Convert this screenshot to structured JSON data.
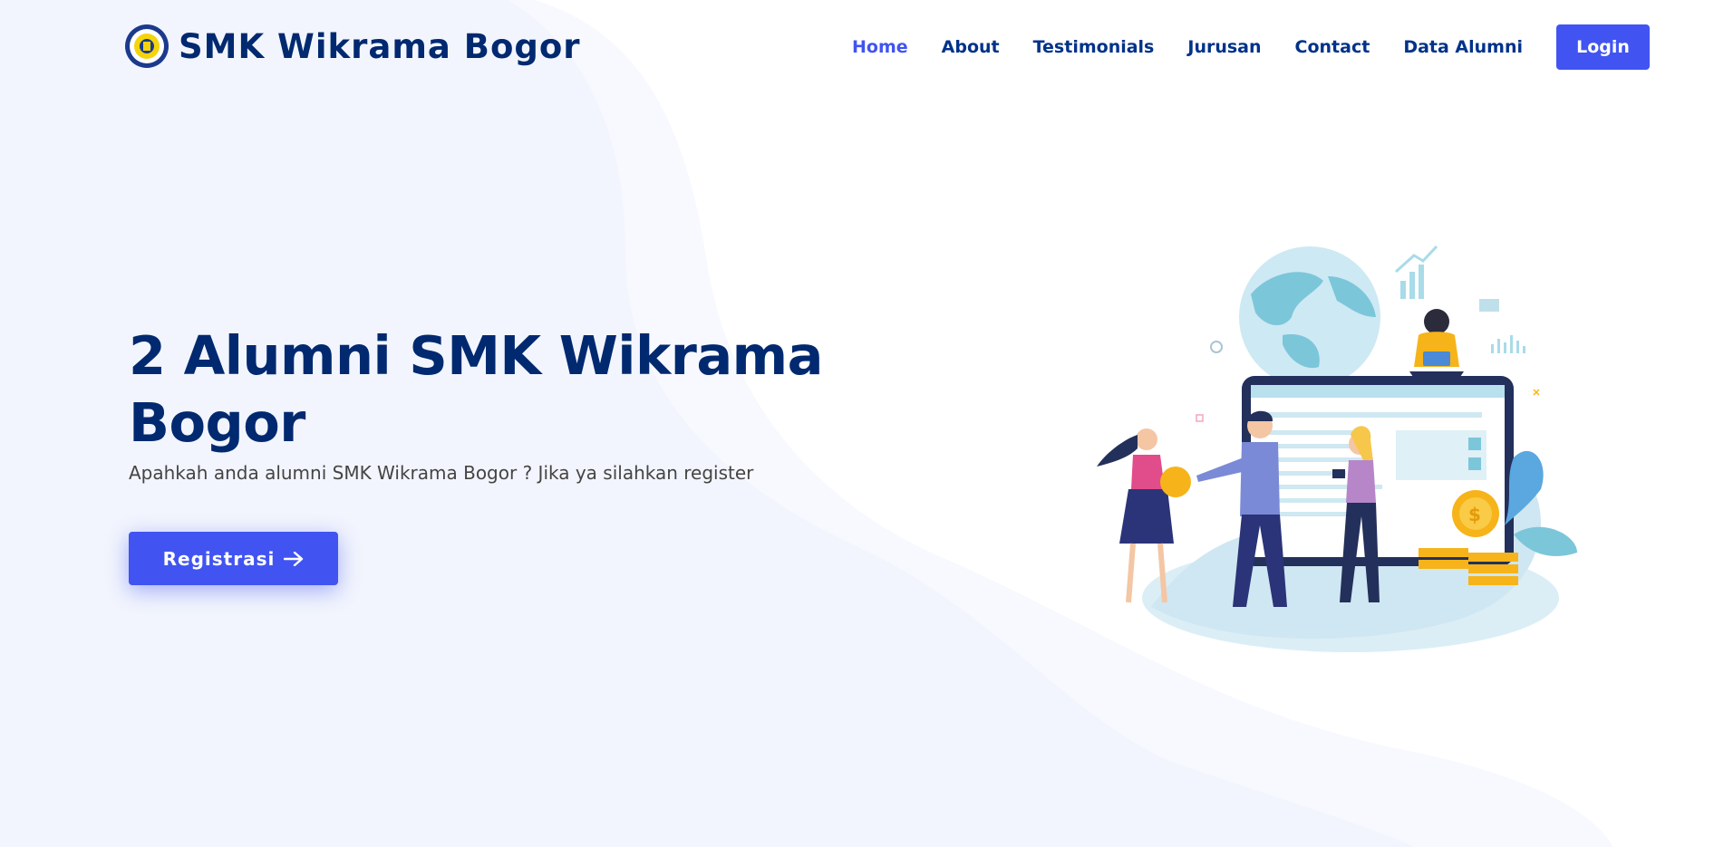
{
  "header": {
    "brand": "SMK Wikrama Bogor",
    "nav": {
      "home": "Home",
      "about": "About",
      "testimonials": "Testimonials",
      "jurusan": "Jurusan",
      "contact": "Contact",
      "data_alumni": "Data Alumni"
    },
    "login_label": "Login"
  },
  "hero": {
    "title": "2 Alumni SMK Wikrama Bogor",
    "subtitle": "Apahkah anda alumni SMK Wikrama Bogor ? Jika ya silahkan register",
    "cta_label": "Registrasi",
    "cta_icon": "arrow-right-icon",
    "illustration": "business-team-illustration"
  },
  "colors": {
    "primary": "#4154f1",
    "heading": "#012970",
    "nav_text": "#013289",
    "body_text": "#444444",
    "wave_light": "#f2f5fd",
    "wave_lighter": "#f8f9fe"
  }
}
